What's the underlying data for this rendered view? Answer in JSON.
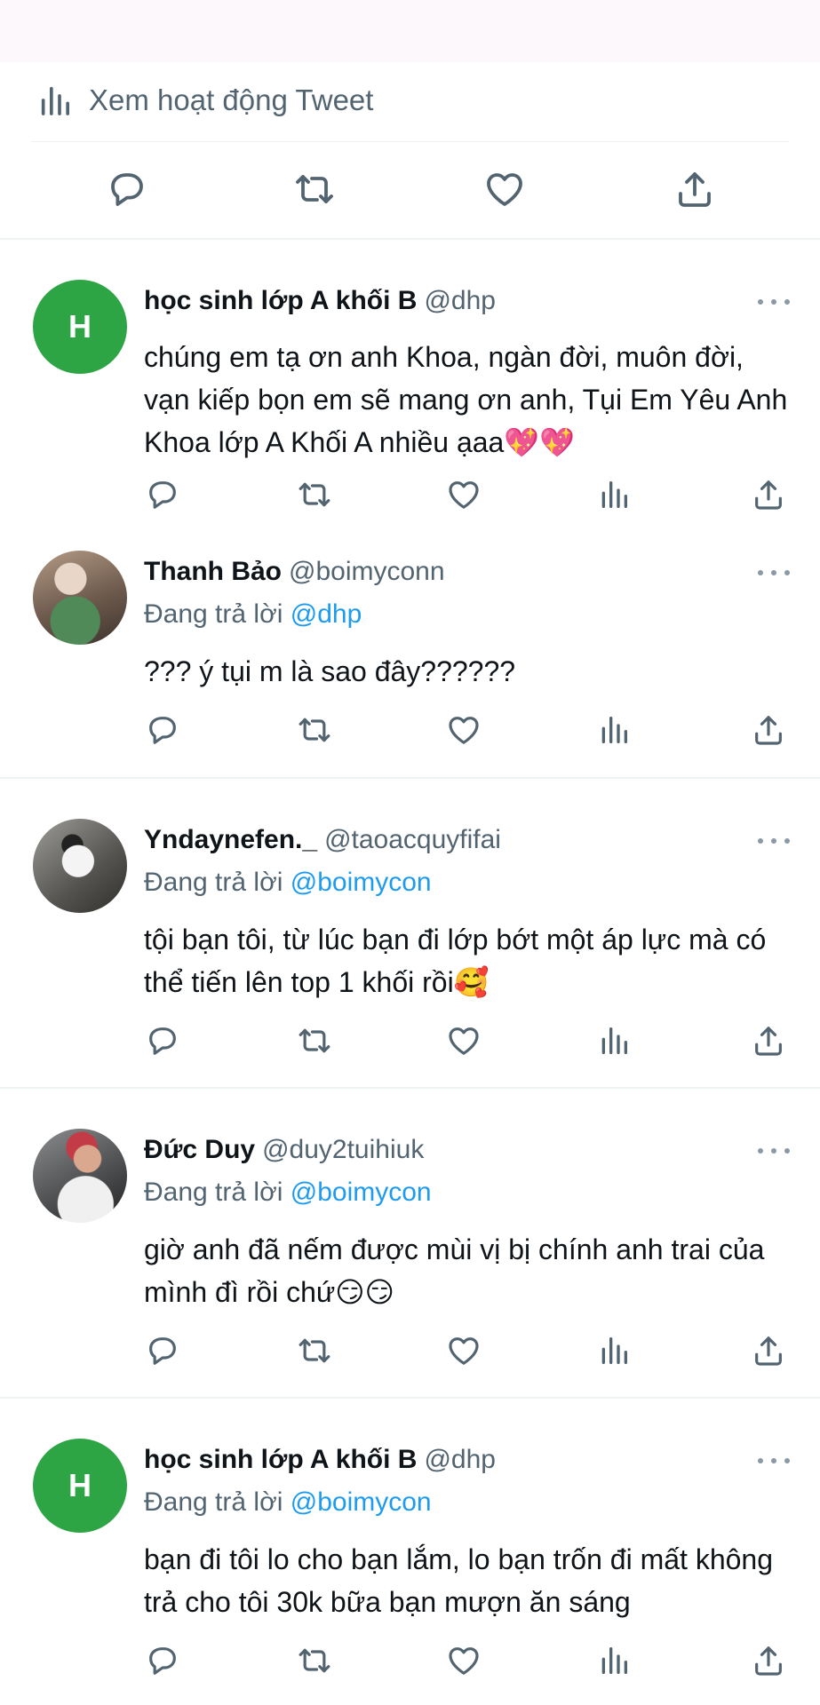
{
  "activity": {
    "label": "Xem hoạt động Tweet"
  },
  "replies": [
    {
      "avatar_letter": "H",
      "name": "học sinh lớp A khối B",
      "handle": "@dhp",
      "replying_prefix": "",
      "replying_to": "",
      "text": "chúng em tạ ơn anh Khoa, ngàn đời, muôn đời, vạn kiếp bọn em sẽ mang ơn anh, Tụi Em Yêu Anh Khoa lớp A Khối A nhiều ạaa💖💖"
    },
    {
      "avatar_letter": "",
      "name": "Thanh Bảo",
      "handle": "@boimyconn",
      "replying_prefix": "Đang trả lời ",
      "replying_to": "@dhp",
      "text": "??? ý tụi m là sao đây??????"
    },
    {
      "avatar_letter": "",
      "name": "Yndaynefen._",
      "handle": "@taoacquyfifai",
      "replying_prefix": "Đang trả lời ",
      "replying_to": "@boimycon",
      "text": "tội bạn tôi, từ lúc bạn đi lớp bớt một áp lực mà có thể tiến lên top 1 khối rồi🥰"
    },
    {
      "avatar_letter": "",
      "name": "Đức Duy",
      "handle": "@duy2tuihiuk",
      "replying_prefix": "Đang trả lời ",
      "replying_to": "@boimycon",
      "text": "giờ anh đã nếm được mùi vị bị chính anh trai của mình đì rồi chứ😏😏"
    },
    {
      "avatar_letter": "H",
      "name": "học sinh lớp A khối B",
      "handle": "@dhp",
      "replying_prefix": "Đang trả lời ",
      "replying_to": "@boimycon",
      "text": "bạn đi tôi lo cho bạn lắm, lo bạn trốn đi mất không trả cho tôi 30k bữa bạn mượn ăn sáng"
    }
  ],
  "icons": {
    "reply": "reply-icon",
    "retweet": "retweet-icon",
    "like": "heart-icon",
    "views": "views-chart-icon",
    "share": "share-icon",
    "more": "more-dots-icon"
  },
  "colors": {
    "text": "#0f1419",
    "secondary": "#536471",
    "mention": "#1d9bf0",
    "avatar_green": "#2ea545",
    "divider": "#eff3f4"
  }
}
